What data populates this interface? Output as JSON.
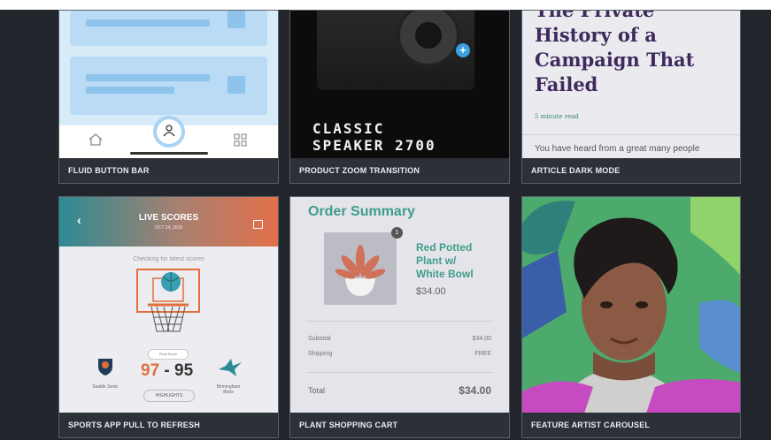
{
  "cards": [
    {
      "caption": "FLUID BUTTON BAR"
    },
    {
      "caption": "PRODUCT ZOOM TRANSITION",
      "speaker_title_1": "CLASSIC",
      "speaker_title_2": "SPEAKER 2700",
      "plus_glyph": "+"
    },
    {
      "caption": "ARTICLE DARK MODE",
      "headline": "The Private History of a Campaign That Failed",
      "read_time": "5 minute read",
      "lede": "You have heard from a great many people"
    },
    {
      "caption": "SPORTS APP PULL TO REFRESH",
      "live_scores": "LIVE SCORES",
      "date": "OCT 24, 2018",
      "checking": "Checking for latest scores",
      "final_score": "Final Score",
      "home_score": "97",
      "dash": "-",
      "away_score": "95",
      "home_team": "Seattle Sonic",
      "away_team": "Birmingham Birds",
      "highlights": "HIGHLIGHTS",
      "back_glyph": "‹"
    },
    {
      "caption": "PLANT SHOPPING CART",
      "order_summary": "Order Summary",
      "badge": "1",
      "product_name": "Red Potted Plant w/ White Bowl",
      "product_price": "$34.00",
      "subtotal_label": "Subtotal",
      "subtotal_value": "$34.00",
      "shipping_label": "Shipping",
      "shipping_value": "FREE",
      "total_label": "Total",
      "total_value": "$34.00"
    },
    {
      "caption": "FEATURE ARTIST CAROUSEL"
    }
  ]
}
